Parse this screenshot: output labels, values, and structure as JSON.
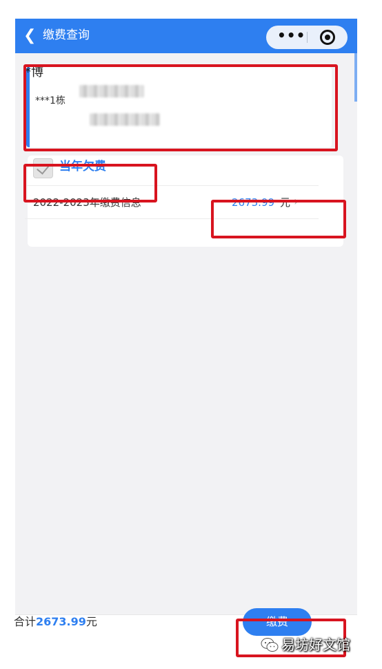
{
  "navbar": {
    "title": "缴费查询",
    "back_icon": "chevron-left-icon",
    "menu_icon": "more-dots-icon",
    "close_icon": "target-circle-icon",
    "background": "#2e7ff0"
  },
  "user_card": {
    "name": "*博",
    "address": "***1栋"
  },
  "arrears": {
    "section_title": "当年欠费",
    "checked": true,
    "items": [
      {
        "label": "2022-2023年缴费信息",
        "amount": "2673.99",
        "unit": "元"
      }
    ]
  },
  "footer": {
    "total_prefix": "合计",
    "total_amount": "2673.99",
    "total_suffix": "元",
    "pay_label": "缴费"
  },
  "watermark": {
    "text": "易坊好文馆"
  },
  "colors": {
    "accent": "#2e7ff0",
    "highlight": "#d8141f",
    "page_bg": "#f2f2f4"
  }
}
